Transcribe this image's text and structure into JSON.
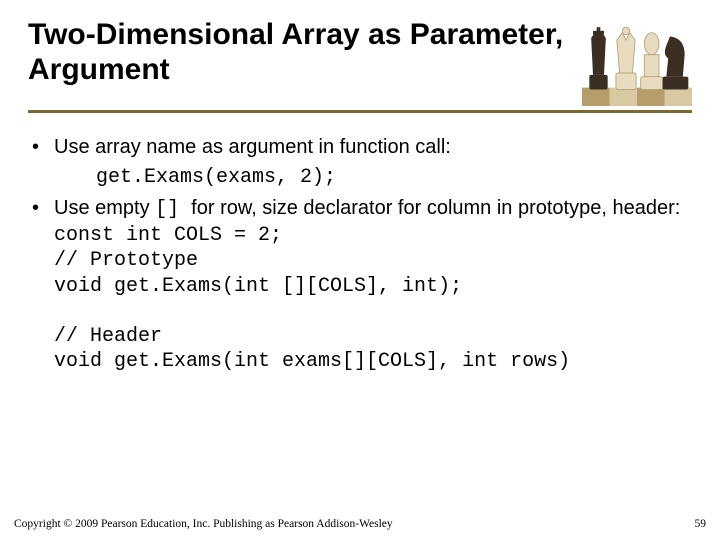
{
  "title": "Two-Dimensional Array as Parameter, Argument",
  "bullet1": "Use array name as argument in function call:",
  "code1": "get.Exams(exams, 2);",
  "bullet2_a": "Use empty ",
  "bullet2_brackets": "[] ",
  "bullet2_b": "for row, size declarator for column in prototype, header:",
  "line_const": "const int COLS = 2;",
  "line_proto_comment": "// Prototype",
  "line_proto": "void get.Exams(int [][COLS], int);",
  "line_header_comment": "// Header",
  "line_header": "void get.Exams(int exams[][COLS], int rows)",
  "footer_copyright": "Copyright © 2009 Pearson Education, Inc. Publishing as Pearson Addison-Wesley",
  "page_number": "59",
  "alt_chess": "Chess pieces"
}
